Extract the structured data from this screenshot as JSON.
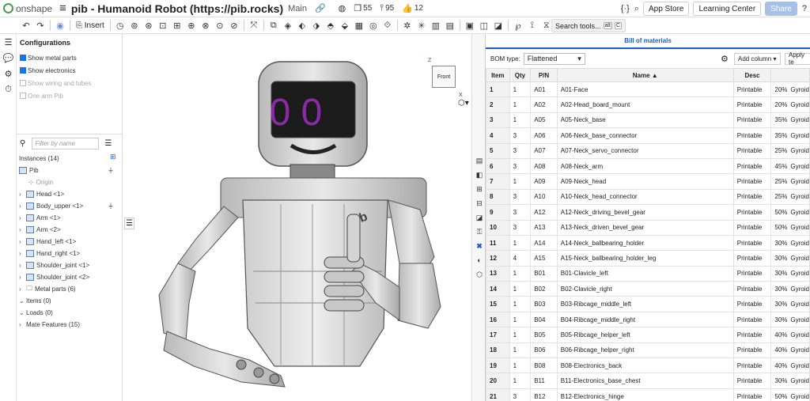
{
  "app": {
    "name": "onshape",
    "doc_title": "pib - Humanoid Robot (https://pib.rocks)",
    "branch": "Main"
  },
  "stats": {
    "versions": "55",
    "pins": "95",
    "likes": "12"
  },
  "topbar_buttons": {
    "app_store": "App Store",
    "learning_center": "Learning Center",
    "share": "Share"
  },
  "toolbar": {
    "insert_label": "Insert",
    "search_tools": "Search tools...",
    "search_kbd1": "alt",
    "search_kbd2": "C"
  },
  "configurations": {
    "title": "Configurations",
    "options": [
      {
        "label": "Show metal parts",
        "checked": true
      },
      {
        "label": "Show electronics",
        "checked": true
      },
      {
        "label": "Show wiring and tubes",
        "checked": false
      },
      {
        "label": "One arm Pib",
        "checked": false
      }
    ]
  },
  "filter_placeholder": "Filter by name",
  "tree": {
    "instances_header": "Instances (14)",
    "root": "Pib",
    "origin": "Origin",
    "items": [
      "Head <1>",
      "Body_upper <1>",
      "Arm <1>",
      "Arm <2>",
      "Hand_left <1>",
      "Hand_right <1>",
      "Shoulder_joint <1>",
      "Shoulder_joint <2>",
      "Metal parts (6)"
    ],
    "groups": [
      "Items (0)",
      "Loads (0)",
      "Mate Features (15)"
    ]
  },
  "viewcube": {
    "face": "Front",
    "axis_z": "Z",
    "axis_x": "X"
  },
  "robot": {
    "eyes": "0 0",
    "brand": "pib"
  },
  "bom": {
    "tab_title": "Bill of materials",
    "type_label": "BOM type:",
    "type_value": "Flattened",
    "add_column": "Add column",
    "apply": "Apply te",
    "columns": [
      "Item",
      "Qty",
      "P/N",
      "Name ▲",
      "Desc",
      ""
    ],
    "rows": [
      [
        "1",
        "1",
        "A01",
        "A01-Face",
        "Printable",
        "20%",
        "Gyroid"
      ],
      [
        "2",
        "1",
        "A02",
        "A02-Head_board_mount",
        "Printable",
        "20%",
        "Gyroid"
      ],
      [
        "3",
        "1",
        "A05",
        "A05-Neck_base",
        "Printable",
        "35%",
        "Gyroid"
      ],
      [
        "4",
        "3",
        "A06",
        "A06-Neck_base_connector",
        "Printable",
        "35%",
        "Gyroid"
      ],
      [
        "5",
        "3",
        "A07",
        "A07-Neck_servo_connector",
        "Printable",
        "25%",
        "Gyroid"
      ],
      [
        "6",
        "3",
        "A08",
        "A08-Neck_arm",
        "Printable",
        "45%",
        "Gyroid"
      ],
      [
        "7",
        "1",
        "A09",
        "A09-Neck_head",
        "Printable",
        "25%",
        "Gyroid"
      ],
      [
        "8",
        "3",
        "A10",
        "A10-Neck_head_connector",
        "Printable",
        "25%",
        "Gyroid"
      ],
      [
        "9",
        "3",
        "A12",
        "A12-Neck_driving_bevel_gear",
        "Printable",
        "50%",
        "Gyroid"
      ],
      [
        "10",
        "3",
        "A13",
        "A13-Neck_driven_bevel_gear",
        "Printable",
        "50%",
        "Gyroid"
      ],
      [
        "11",
        "1",
        "A14",
        "A14-Neck_ballbearing_holder",
        "Printable",
        "30%",
        "Gyroid"
      ],
      [
        "12",
        "4",
        "A15",
        "A15-Neck_ballbearing_holder_leg",
        "Printable",
        "30%",
        "Gyroid"
      ],
      [
        "13",
        "1",
        "B01",
        "B01-Clavicle_left",
        "Printable",
        "30%",
        "Gyroid"
      ],
      [
        "14",
        "1",
        "B02",
        "B02-Clavicle_right",
        "Printable",
        "30%",
        "Gyroid"
      ],
      [
        "15",
        "1",
        "B03",
        "B03-Ribcage_middle_left",
        "Printable",
        "30%",
        "Gyroid"
      ],
      [
        "16",
        "1",
        "B04",
        "B04-Ribcage_middle_right",
        "Printable",
        "30%",
        "Gyroid"
      ],
      [
        "17",
        "1",
        "B05",
        "B05-Ribcage_helper_left",
        "Printable",
        "40%",
        "Gyroid"
      ],
      [
        "18",
        "1",
        "B06",
        "B06-Ribcage_helper_right",
        "Printable",
        "40%",
        "Gyroid"
      ],
      [
        "19",
        "1",
        "B08",
        "B08-Electronics_back",
        "Printable",
        "40%",
        "Gyroid"
      ],
      [
        "20",
        "1",
        "B11",
        "B11-Electronics_base_chest",
        "Printable",
        "30%",
        "Gyroid"
      ],
      [
        "21",
        "3",
        "B12",
        "B12-Electronics_hinge",
        "Printable",
        "50%",
        "Gyroid"
      ]
    ]
  },
  "colors": {
    "accent": "#1a5cc8",
    "eyes": "#8a2aa8",
    "share_btn": "#a7c0e6"
  }
}
